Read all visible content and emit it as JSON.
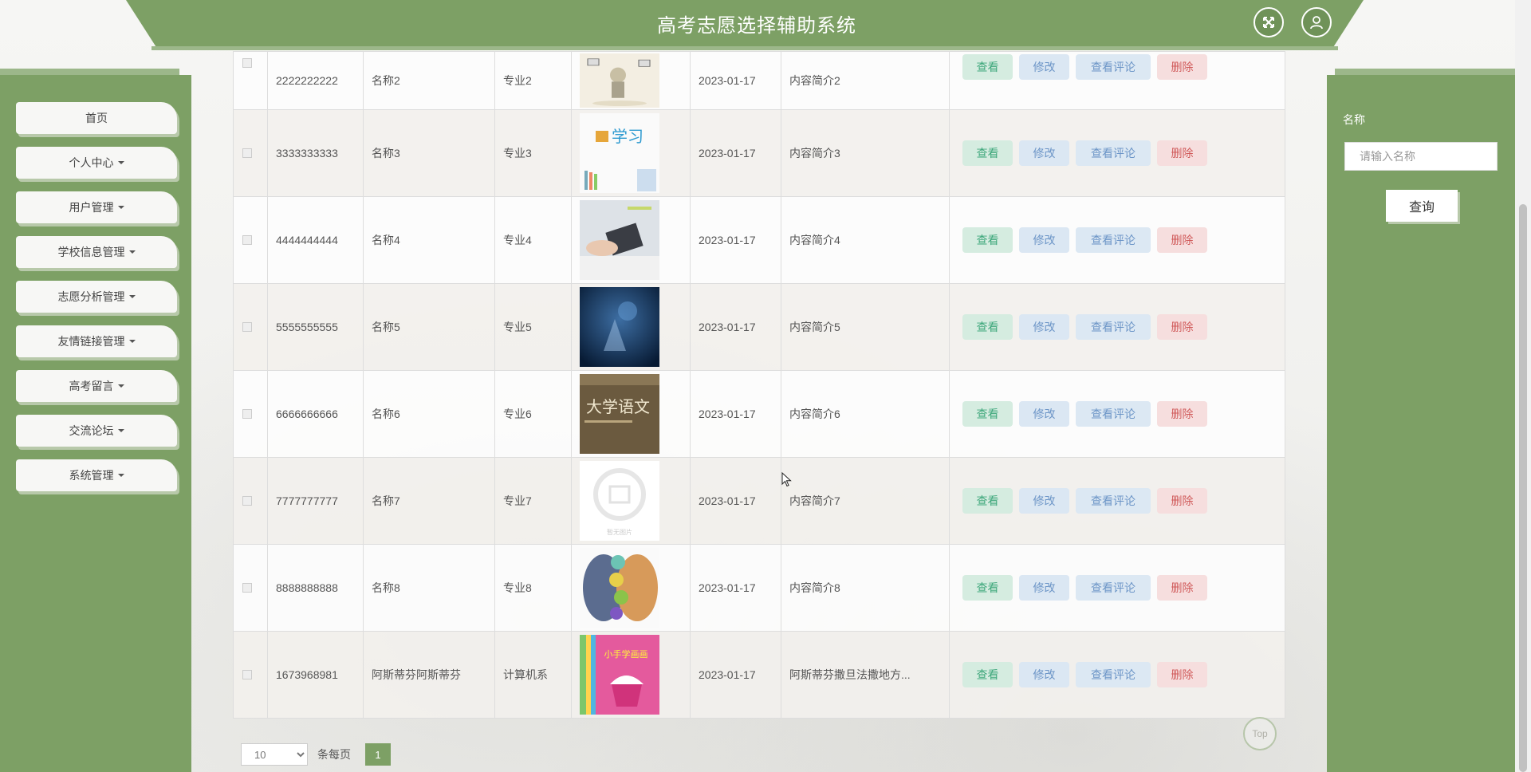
{
  "header": {
    "title": "高考志愿选择辅助系统",
    "fullscreen_icon": "fullscreen-icon",
    "user_icon": "user-icon"
  },
  "sidebar": {
    "items": [
      {
        "label": "首页",
        "has_caret": false
      },
      {
        "label": "个人中心",
        "has_caret": true
      },
      {
        "label": "用户管理",
        "has_caret": true
      },
      {
        "label": "学校信息管理",
        "has_caret": true
      },
      {
        "label": "志愿分析管理",
        "has_caret": true
      },
      {
        "label": "友情链接管理",
        "has_caret": true
      },
      {
        "label": "高考留言",
        "has_caret": true
      },
      {
        "label": "交流论坛",
        "has_caret": true
      },
      {
        "label": "系统管理",
        "has_caret": true
      }
    ]
  },
  "search": {
    "label": "名称",
    "placeholder": "请输入名称",
    "button": "查询"
  },
  "actions": {
    "view": "查看",
    "edit": "修改",
    "comments": "查看评论",
    "delete": "删除"
  },
  "rows": [
    {
      "id": "2222222222",
      "name": "名称2",
      "major": "专业2",
      "date": "2023-01-17",
      "intro": "内容简介2",
      "image": "cartoon-figure-image"
    },
    {
      "id": "3333333333",
      "name": "名称3",
      "major": "专业3",
      "date": "2023-01-17",
      "intro": "内容简介3",
      "image": "study-logo-image"
    },
    {
      "id": "4444444444",
      "name": "名称4",
      "major": "专业4",
      "date": "2023-01-17",
      "intro": "内容简介4",
      "image": "calculator-hand-image"
    },
    {
      "id": "5555555555",
      "name": "名称5",
      "major": "专业5",
      "date": "2023-01-17",
      "intro": "内容简介5",
      "image": "tech-blue-image"
    },
    {
      "id": "6666666666",
      "name": "名称6",
      "major": "专业6",
      "date": "2023-01-17",
      "intro": "内容简介6",
      "image": "book-cover-image",
      "image_text": "大学语文"
    },
    {
      "id": "7777777777",
      "name": "名称7",
      "major": "专业7",
      "date": "2023-01-17",
      "intro": "内容简介7",
      "image": "placeholder-image",
      "image_text": "暂无图片"
    },
    {
      "id": "8888888888",
      "name": "名称8",
      "major": "专业8",
      "date": "2023-01-17",
      "intro": "内容简介8",
      "image": "infographic-image"
    },
    {
      "id": "1673968981",
      "name": "阿斯蒂芬阿斯蒂芬",
      "major": "计算机系",
      "date": "2023-01-17",
      "intro": "阿斯蒂芬撒旦法撒地方...",
      "image": "childrens-book-image",
      "image_text": "小手学画画"
    }
  ],
  "pagination": {
    "page_size": "10",
    "per_page_label": "条每页",
    "current_page": "1"
  },
  "top_button": "Top",
  "colors": {
    "primary_green": "#7da065",
    "view": "#3ea77b",
    "edit": "#6c95c7",
    "delete": "#d05a5a"
  }
}
